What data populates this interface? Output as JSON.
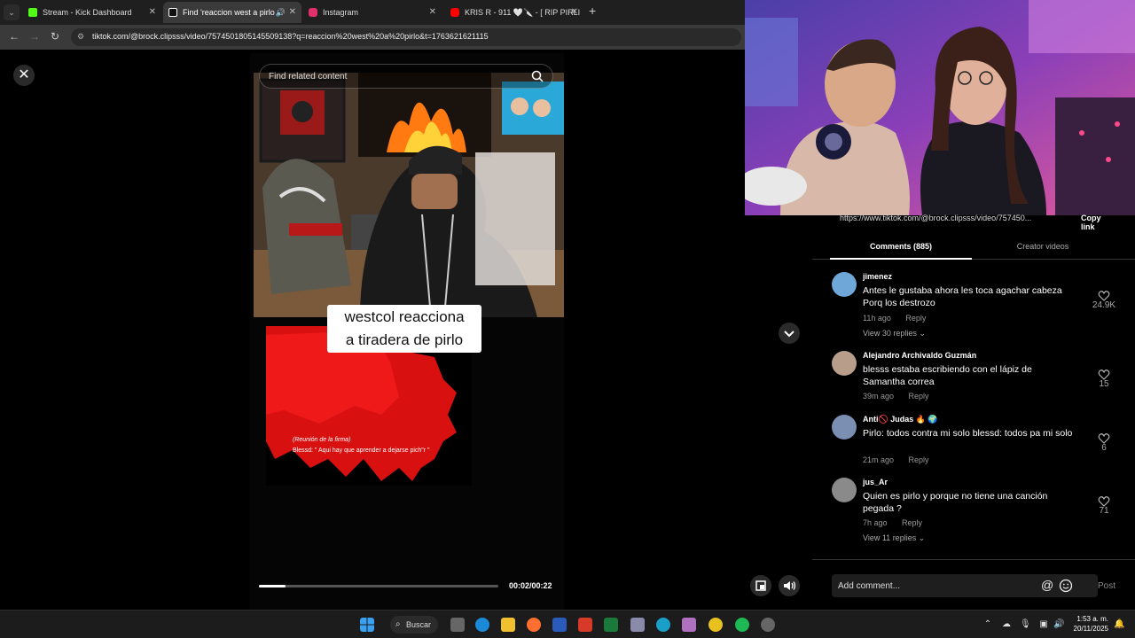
{
  "browser": {
    "tab_menu": "⌄",
    "tabs": [
      {
        "label": "Stream - Kick Dashboard",
        "favicon_color": "#53fc18"
      },
      {
        "label": "Find 'reaccion west a pirlo",
        "favicon_color": "#ffffff"
      },
      {
        "label": "Instagram",
        "favicon_color": "#e1306c"
      },
      {
        "label": "KRIS R - 911 🤍🔪 - [ RIP PIRLI",
        "favicon_color": "#ff0000"
      }
    ],
    "new_tab": "+",
    "url": "tiktok.com/@brock.clipsss/video/7574501805145509138?q=reaccion%20west%20a%20pirlo&t=1763621621115"
  },
  "video": {
    "search_placeholder": "Find related content",
    "caption_line1": "westcol reacciona",
    "caption_line2": "a tiradera de pirlo",
    "quote_1": "(Reunión de la firma)",
    "quote_2": "Blessd: \" Aqui hay que aprender a dejarse pich\"r \"",
    "time": "00:02/00:22",
    "progress": 0.11
  },
  "panel": {
    "link": "https://www.tiktok.com/@brock.clipsss/video/757450...",
    "copy_link": "Copy link",
    "tab_comments": "Comments (885)",
    "tab_creator": "Creator videos",
    "comments": [
      {
        "user": "jimenez",
        "text": "Antes le gustaba ahora les toca agachar cabeza Porq los destrozo",
        "time": "11h ago",
        "reply": "Reply",
        "likes": "24.9K",
        "replies": "View 30 replies ⌄",
        "avatar_color": "#6fa7d8"
      },
      {
        "user": "Alejandro Archivaldo Guzmán",
        "text": "blesss estaba escribiendo con el lápiz de Samantha correa",
        "time": "39m ago",
        "reply": "Reply",
        "likes": "15",
        "replies": "",
        "avatar_color": "#b79d8a"
      },
      {
        "user": "Anti🚫 Judas 🔥 🌍",
        "text": "Pirlo: todos contra mi solo blessd: todos pa mi solo",
        "time": "21m ago",
        "reply": "Reply",
        "likes": "6",
        "replies": "",
        "avatar_color": "#7b8fb3"
      },
      {
        "user": "jus_Ar",
        "text": "Quien es pirlo y porque no tiene una canción pegada ?",
        "time": "7h ago",
        "reply": "Reply",
        "likes": "71",
        "replies": "View 11 replies ⌄",
        "avatar_color": "#8a8a8a"
      }
    ],
    "add_comment": "Add comment...",
    "at_symbol": "@",
    "post": "Post"
  },
  "taskbar": {
    "search": "Buscar",
    "time": "1:53 a. m.",
    "date": "20/11/2025"
  }
}
